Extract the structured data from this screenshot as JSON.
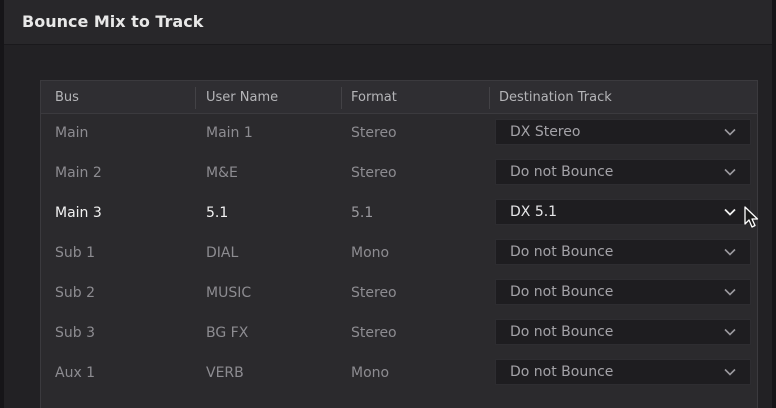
{
  "dialog": {
    "title": "Bounce Mix to Track"
  },
  "table": {
    "headers": {
      "bus": "Bus",
      "user_name": "User Name",
      "format": "Format",
      "destination": "Destination Track"
    },
    "rows": [
      {
        "bus": "Main",
        "user_name": "Main 1",
        "format": "Stereo",
        "destination": "DX Stereo"
      },
      {
        "bus": "Main 2",
        "user_name": "M&E",
        "format": "Stereo",
        "destination": "Do not Bounce"
      },
      {
        "bus": "Main 3",
        "user_name": "5.1",
        "format": "5.1",
        "destination": "DX 5.1"
      },
      {
        "bus": "Sub 1",
        "user_name": "DIAL",
        "format": "Mono",
        "destination": "Do not Bounce"
      },
      {
        "bus": "Sub 2",
        "user_name": "MUSIC",
        "format": "Stereo",
        "destination": "Do not Bounce"
      },
      {
        "bus": "Sub 3",
        "user_name": "BG FX",
        "format": "Stereo",
        "destination": "Do not Bounce"
      },
      {
        "bus": "Aux 1",
        "user_name": "VERB",
        "format": "Mono",
        "destination": "Do not Bounce"
      }
    ],
    "selected_row": 2
  },
  "icons": {
    "dropdown": "chevron-down-icon",
    "cursor": "mouse-pointer-icon"
  }
}
